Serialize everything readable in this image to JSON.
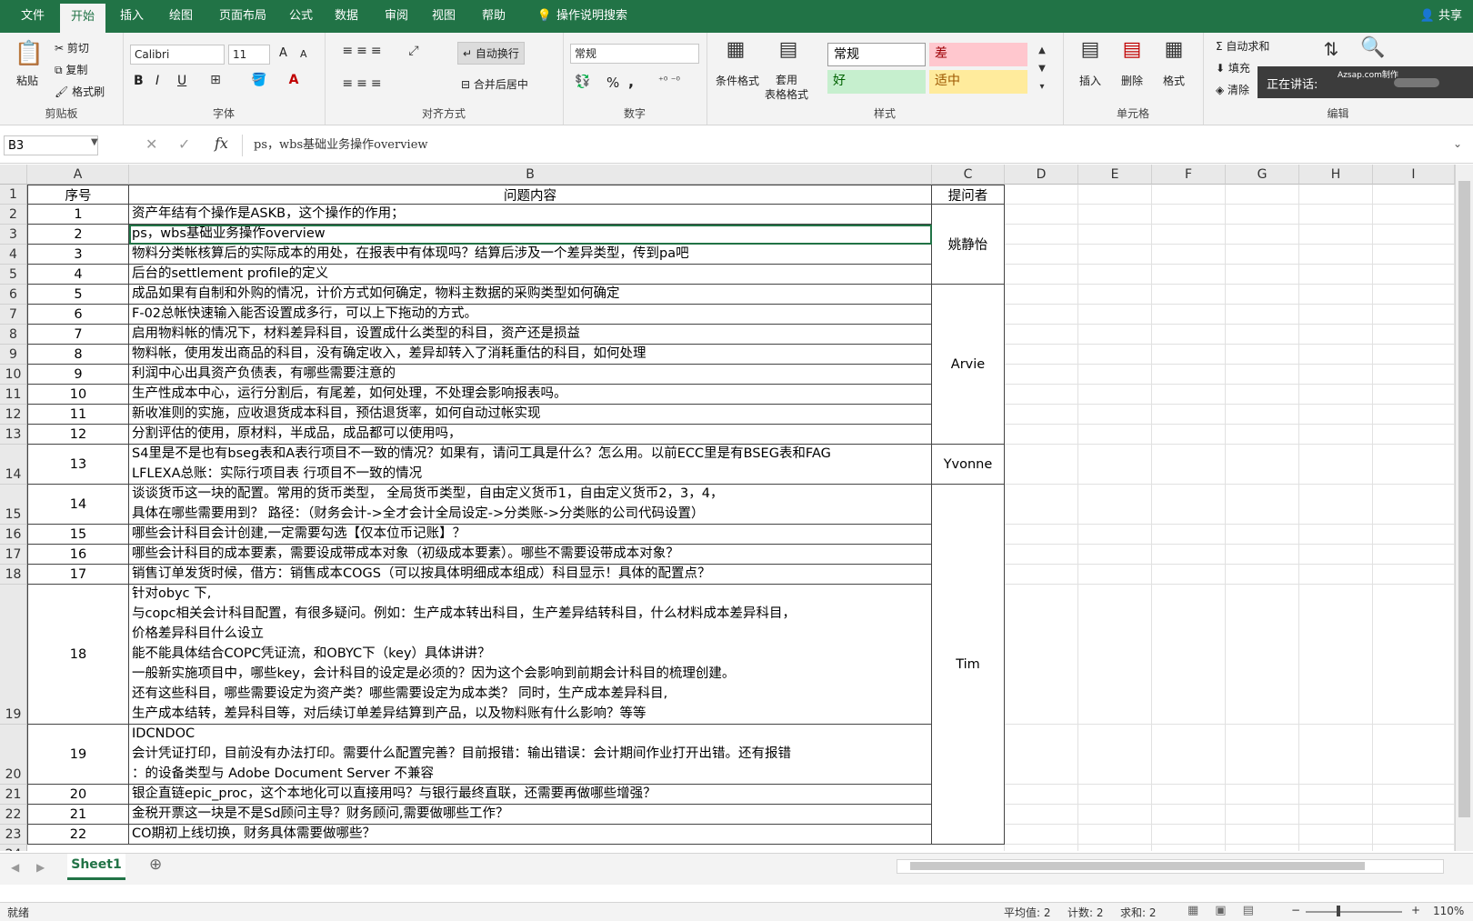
{
  "tabs": [
    {
      "label": "文件"
    },
    {
      "label": "开始",
      "active": true
    },
    {
      "label": "插入"
    },
    {
      "label": "绘图"
    },
    {
      "label": "页面布局"
    },
    {
      "label": "公式"
    },
    {
      "label": "数据"
    },
    {
      "label": "审阅"
    },
    {
      "label": "视图"
    },
    {
      "label": "帮助"
    }
  ],
  "tellme": "操作说明搜索",
  "share": "共享",
  "ribbon": {
    "clipboard": {
      "paste": "粘贴",
      "cut": "剪切",
      "copy": "复制",
      "format_painter": "格式刷",
      "label": "剪贴板"
    },
    "font": {
      "name": "Calibri",
      "size": "11",
      "grow": "A",
      "shrink": "A",
      "bold": "B",
      "italic": "I",
      "underline": "U",
      "label": "字体"
    },
    "align": {
      "wrap": "自动换行",
      "merge": "合并后居中",
      "label": "对齐方式"
    },
    "number": {
      "format": "常规",
      "percent": "%",
      "comma": ",",
      "label": "数字"
    },
    "styles": {
      "cond": "条件格式",
      "table": "套用\n表格格式",
      "normal": "常规",
      "bad": "差",
      "good": "好",
      "neutral": "适中",
      "label": "样式"
    },
    "cells": {
      "insert": "插入",
      "delete": "删除",
      "format": "格式",
      "label": "单元格"
    },
    "edit": {
      "autosum": "自动求和",
      "fill": "填充",
      "clear": "清除",
      "label": "编辑"
    }
  },
  "popup": {
    "title": "正在讲话:",
    "brand": "Azsap.com制作"
  },
  "namebox": "B3",
  "formula": "ps，wbs基础业务操作overview",
  "colors": {
    "green": "#217346",
    "bad_bg": "#ffc7ce",
    "bad_fg": "#9c0006",
    "good_bg": "#c6efce",
    "good_fg": "#006100",
    "neutral_bg": "#ffeb9c",
    "neutral_fg": "#9c5700"
  },
  "columns": [
    "A",
    "B",
    "C",
    "D",
    "E",
    "F",
    "G",
    "H",
    "I"
  ],
  "header": {
    "a": "序号",
    "b": "问题内容",
    "c": "提问者"
  },
  "rows": [
    {
      "n": "1",
      "a": "1",
      "b": "资产年结有个操作是ASKB，这个操作的作用；"
    },
    {
      "n": "2",
      "a": "2",
      "b": "ps，wbs基础业务操作overview"
    },
    {
      "n": "3",
      "a": "3",
      "b": "物料分类帐核算后的实际成本的用处，在报表中有体现吗？结算后涉及一个差异类型，传到pa吧"
    },
    {
      "n": "4",
      "a": "4",
      "b": "后台的settlement profile的定义"
    },
    {
      "n": "5",
      "a": "5",
      "b": "成品如果有自制和外购的情况，计价方式如何确定，物料主数据的采购类型如何确定"
    },
    {
      "n": "6",
      "a": "6",
      "b": "F-02总帐快速输入能否设置成多行，可以上下拖动的方式。"
    },
    {
      "n": "7",
      "a": "7",
      "b": "启用物料帐的情况下，材料差异科目，设置成什么类型的科目，资产还是损益"
    },
    {
      "n": "8",
      "a": "8",
      "b": "物料帐，使用发出商品的科目，没有确定收入，差异却转入了消耗重估的科目，如何处理"
    },
    {
      "n": "9",
      "a": "9",
      "b": "利润中心出具资产负债表，有哪些需要注意的"
    },
    {
      "n": "10",
      "a": "10",
      "b": "生产性成本中心，运行分割后，有尾差，如何处理，不处理会影响报表吗。"
    },
    {
      "n": "11",
      "a": "11",
      "b": "新收准则的实施，应收退货成本科目，预估退货率，如何自动过帐实现"
    },
    {
      "n": "12",
      "a": "12",
      "b": "分割评估的使用，原材料，半成品，成品都可以使用吗，"
    },
    {
      "n": "13",
      "a": "13",
      "b": "S4里是不是也有bseg表和A表行项目不一致的情况？如果有，请问工具是什么？怎么用。以前ECC里是有BSEG表和FAG\nLFLEXA总账：实际行项目表 行项目不一致的情况"
    },
    {
      "n": "14",
      "a": "14",
      "b": "谈谈货币这一块的配置。常用的货币类型， 全局货币类型，自由定义货币1，自由定义货币2，3，4，\n具体在哪些需要用到？ 路径：（财务会计->全才会计全局设定->分类账->分类账的公司代码设置）"
    },
    {
      "n": "15",
      "a": "15",
      "b": "哪些会计科目会计创建,一定需要勾选【仅本位币记账】？"
    },
    {
      "n": "16",
      "a": "16",
      "b": "哪些会计科目的成本要素，需要设成带成本对象（初级成本要素）。哪些不需要设带成本对象？"
    },
    {
      "n": "17",
      "a": "17",
      "b": "销售订单发货时候，借方：销售成本COGS（可以按具体明细成本组成）科目显示！具体的配置点？"
    },
    {
      "n": "18",
      "a": "18",
      "b": "针对obyc 下,\n与copc相关会计科目配置，有很多疑问。例如：生产成本转出科目，生产差异结转科目，什么材料成本差异科目，\n价格差异科目什么设立\n能不能具体结合COPC凭证流，和OBYC下（key）具体讲讲？\n一般新实施项目中，哪些key，会计科目的设定是必须的？因为这个会影响到前期会计科目的梳理创建。\n还有这些科目，哪些需要设定为资产类？哪些需要设定为成本类？ 同时，生产成本差异科目,\n生产成本结转，差异科目等，对后续订单差异结算到产品，以及物料账有什么影响？等等"
    },
    {
      "n": "19",
      "a": "19",
      "b": "IDCNDOC\n会计凭证打印，目前没有办法打印。需要什么配置完善？目前报错：输出错误：会计期间作业打开出错。还有报错\n：的设备类型与 Adobe Document Server 不兼容"
    },
    {
      "n": "20",
      "a": "20",
      "b": "银企直链epic_proc，这个本地化可以直接用吗？与银行最终直联，还需要再做哪些增强？"
    },
    {
      "n": "21",
      "a": "21",
      "b": "金税开票这一块是不是Sd顾问主导？财务顾问,需要做哪些工作？"
    },
    {
      "n": "22",
      "a": "22",
      "b": "CO期初上线切换，财务具体需要做哪些？"
    }
  ],
  "row_labels": [
    "1",
    "2",
    "3",
    "4",
    "5",
    "6",
    "7",
    "8",
    "9",
    "10",
    "11",
    "12",
    "13",
    "14",
    "15",
    "16",
    "17",
    "18",
    "19",
    "20",
    "21",
    "22",
    "23",
    "24"
  ],
  "askers": [
    "姚静怡",
    "Arvie",
    "Yvonne",
    "Tim"
  ],
  "sheet": "Sheet1",
  "status": {
    "ready": "就绪",
    "avg": "平均值: 2",
    "count": "计数: 2",
    "sum": "求和: 2",
    "zoom": "110%"
  }
}
